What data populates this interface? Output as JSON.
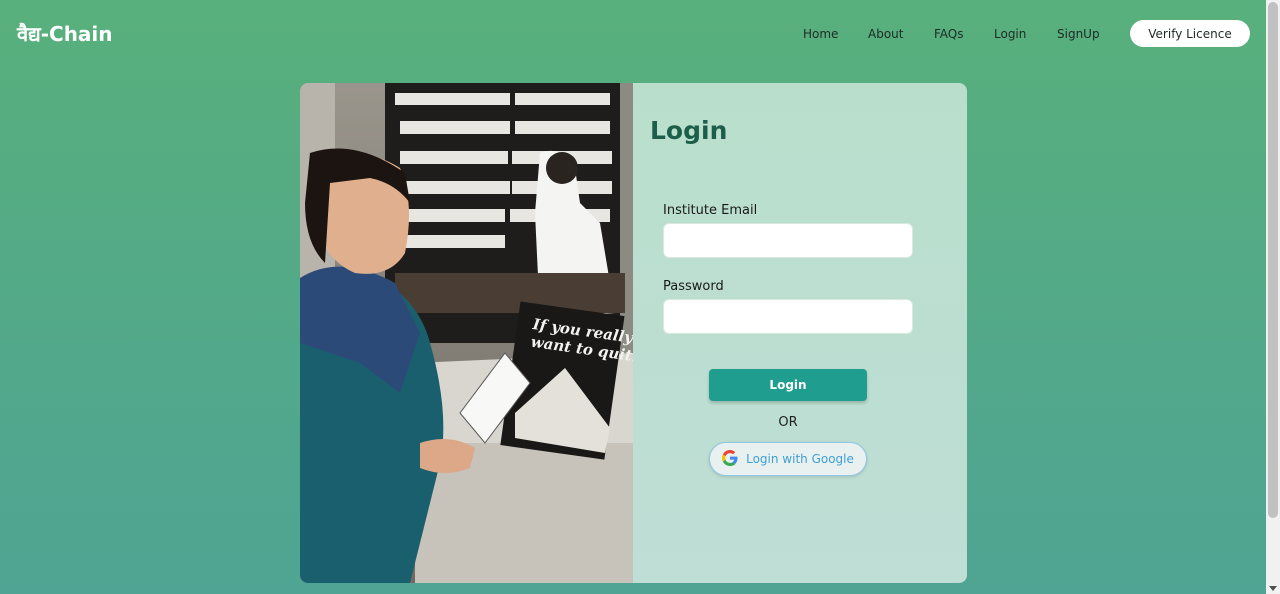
{
  "brand": {
    "name": "वैद्य-Chain"
  },
  "nav": {
    "links": [
      {
        "label": "Home"
      },
      {
        "label": "About"
      },
      {
        "label": "FAQs"
      },
      {
        "label": "Login"
      },
      {
        "label": "SignUp"
      }
    ],
    "verify_label": "Verify Licence"
  },
  "photo": {
    "poster_line1": "If you really",
    "poster_line2": "want to quit."
  },
  "form": {
    "title": "Login",
    "email_label": "Institute Email",
    "email_value": "",
    "password_label": "Password",
    "password_value": "",
    "login_label": "Login",
    "or_text": "OR",
    "google_label": "Login with Google"
  },
  "colors": {
    "accent": "#1f9e8f",
    "title": "#1d5e4b",
    "google_text": "#3f9fd6"
  }
}
